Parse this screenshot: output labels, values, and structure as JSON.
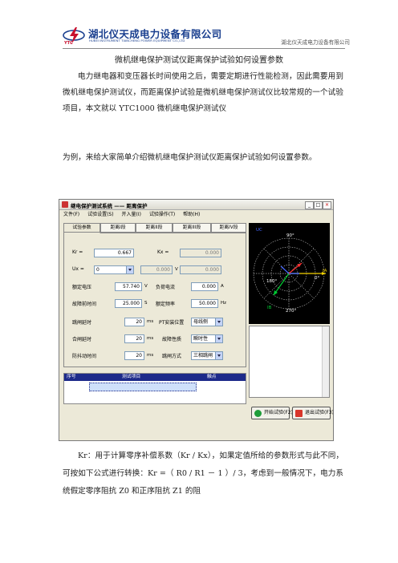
{
  "header": {
    "logo_cn": "湖北仪天成电力设备有限公司",
    "logo_en": "HUBEI INSTRUMENT TIANCHENG POWER EQUIPMENT CO.,LTD",
    "logo_abbr": "YTC",
    "company_right": "湖北仪天成电力设备有限公司"
  },
  "doc": {
    "title": "微机继电保护测试仪距离保护试验如何设置参数",
    "para1": "电力继电器和变压器长时间使用之后，需要定期进行性能检测，因此需要用到微机继电保护测试仪，而距离保护试验是微机继电保护测试仪比较常规的一个试验项目，本文就以 YTC1000 微机继电保护测试仪",
    "para2": "为例，来给大家简单介绍微机继电保护测试仪距离保护试验如何设置参数。",
    "para3": "Kr：用于计算零序补偿系数（Kr / Kx），如果定值所给的参数形式与此不同，可按如下公式进行转换：Kr =（ R0 / R1 － 1 ）/ 3，考虑到一般情况下，电力系统假定零序阻抗 Z0 和正序阻抗 Z1 的阻"
  },
  "app": {
    "window_title": "继电保护测试系统 —— 距离保护",
    "menu": [
      "文件(F)",
      "试验设置(S)",
      "开入量(I)",
      "试验操作(T)",
      "帮助(H)"
    ],
    "tabs": [
      "试验参数",
      "距离I段",
      "距离II段",
      "距离III段",
      "距离IV段"
    ],
    "kr_label": "Kr =",
    "kr_value": "0.667",
    "kx_label": "Kx =",
    "kx_value": "0.000",
    "ux_label": "Ux =",
    "ux_value": "0",
    "ux_extra": "0.000",
    "ux_unit": "V",
    "rated_voltage_label": "额定电压",
    "rated_voltage": "57.740",
    "rated_voltage_unit": "V",
    "load_current_label": "负荷电流",
    "load_current": "0.000",
    "load_current_unit": "A",
    "prefault_time_label": "故障前时间",
    "prefault_time": "25.000",
    "prefault_time_unit": "S",
    "rated_freq_label": "额定频率",
    "rated_freq": "50.000",
    "rated_freq_unit": "Hz",
    "trip_delay_label": "跳闸延时",
    "trip_delay": "20",
    "trip_delay_unit": "ms",
    "pt_label": "PT安装位置",
    "pt_value": "母线侧",
    "close_delay_label": "合闸延时",
    "close_delay": "20",
    "close_delay_unit": "ms",
    "fault_nature_label": "故障性质",
    "fault_nature_value": "瞬时性",
    "anti_jitter_label": "防抖动时间",
    "anti_jitter": "20",
    "anti_jitter_unit": "ms",
    "reclose_label": "跳闸方式",
    "reclose_value": "三相跳闸",
    "table_headers": [
      "序号",
      "测试项目",
      "触点"
    ],
    "polar": {
      "top": "90°",
      "left": "180°",
      "right": "0°",
      "bottom": "270°",
      "ua": "IA",
      "ub": "UB",
      "uc": "UC",
      "ib": "IB"
    },
    "start_button": "开始试验(F2)",
    "exit_button": "退出试验(F3)"
  },
  "colors": {
    "table_header": "#1d2a8a",
    "polar_bg": "#000000",
    "vec_a": "#f5d400",
    "vec_b": "#00cc33",
    "vec_c": "#ff3030",
    "vec_i": "#4466ff"
  }
}
